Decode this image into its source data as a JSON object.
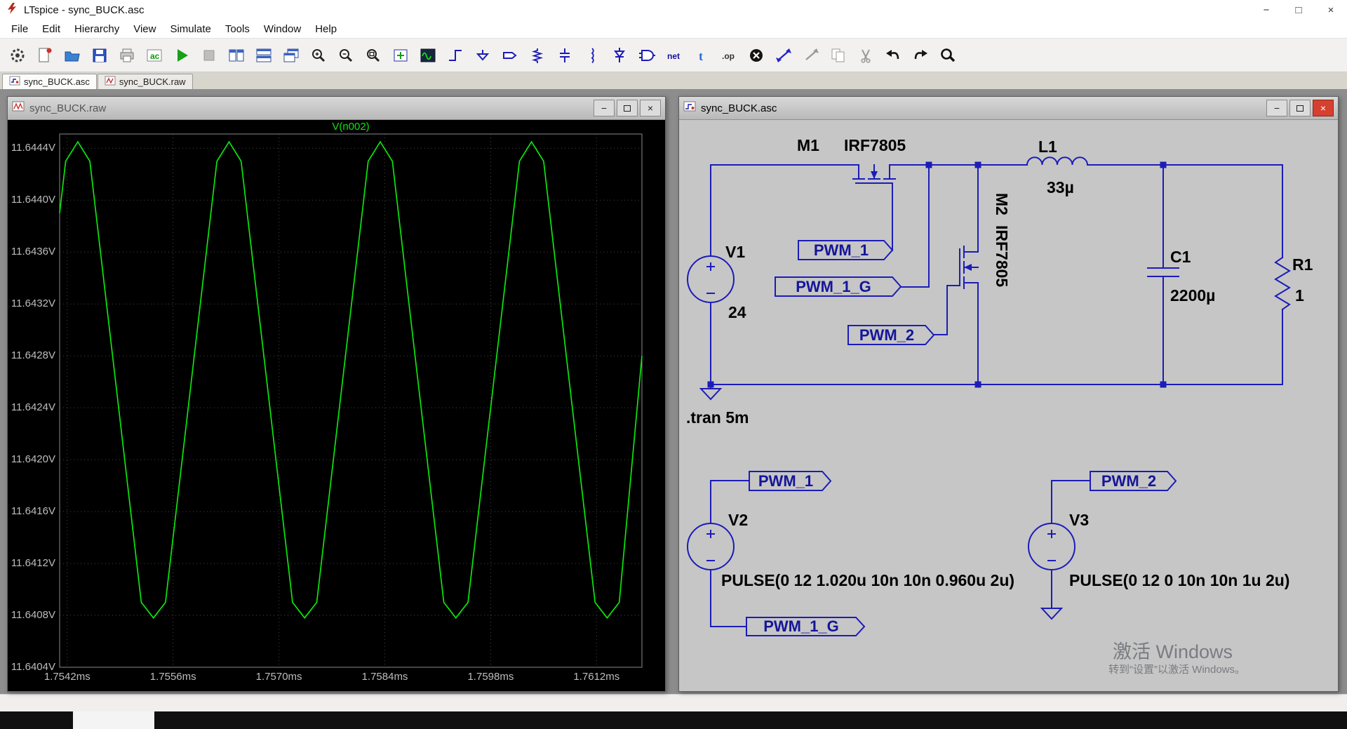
{
  "window": {
    "title": "LTspice - sync_BUCK.asc",
    "controls": {
      "minimize": "−",
      "maximize": "□",
      "close": "×"
    }
  },
  "menu": {
    "items": [
      "File",
      "Edit",
      "Hierarchy",
      "View",
      "Simulate",
      "Tools",
      "Window",
      "Help"
    ]
  },
  "toolbar": {
    "icons": [
      "control-panel",
      "new-schematic",
      "open-file",
      "save",
      "print",
      "ac-analysis",
      "run",
      "halt",
      "tile-vertical",
      "tile-horizontal",
      "cascade-windows",
      "zoom-in",
      "zoom-out",
      "zoom-full-extents",
      "pan-view",
      "plot-settings",
      "draw-wire",
      "place-ground",
      "label-net",
      "place-resistor",
      "place-capacitor",
      "place-inductor",
      "place-diode",
      "place-component",
      "highlight-net",
      "place-text",
      "spice-directive",
      "delete-mode",
      "move-mode",
      "drag-mode",
      "copy-mode",
      "cut-mode",
      "undo",
      "redo",
      "find"
    ]
  },
  "tabs": [
    {
      "label": "sync_BUCK.asc"
    },
    {
      "label": "sync_BUCK.raw"
    }
  ],
  "wave_window": {
    "title": "sync_BUCK.raw"
  },
  "chart_data": {
    "type": "line",
    "title": "V(n002)",
    "trace_color": "#0ce60c",
    "legend_position": "top",
    "grid": true,
    "xlim": [
      1.7541,
      1.7618
    ],
    "ylim": [
      11.6404,
      11.64451
    ],
    "x_unit": "ms",
    "y_unit": "V",
    "x_ticks": [
      1.7542,
      1.7556,
      1.757,
      1.7584,
      1.7598,
      1.7612
    ],
    "x_tick_labels": [
      "1.7542ms",
      "1.7556ms",
      "1.7570ms",
      "1.7584ms",
      "1.7598ms",
      "1.7612ms"
    ],
    "y_ticks": [
      11.6444,
      11.644,
      11.6436,
      11.6432,
      11.6428,
      11.6424,
      11.642,
      11.6416,
      11.6412,
      11.6408,
      11.6404
    ],
    "y_tick_labels": [
      "11.6444V",
      "11.6440V",
      "11.6436V",
      "11.6432V",
      "11.6428V",
      "11.6424V",
      "11.6420V",
      "11.6416V",
      "11.6412V",
      "11.6408V",
      "11.6404V"
    ],
    "series": [
      {
        "name": "V(n002)",
        "points": [
          [
            1.7541,
            11.6439
          ],
          [
            1.75418,
            11.6443
          ],
          [
            1.75434,
            11.64445
          ],
          [
            1.7545,
            11.6443
          ],
          [
            1.75484,
            11.6426
          ],
          [
            1.75518,
            11.6409
          ],
          [
            1.75534,
            11.64078
          ],
          [
            1.7555,
            11.6409
          ],
          [
            1.75584,
            11.6426
          ],
          [
            1.75618,
            11.6443
          ],
          [
            1.75634,
            11.64445
          ],
          [
            1.7565,
            11.6443
          ],
          [
            1.75684,
            11.6426
          ],
          [
            1.75718,
            11.6409
          ],
          [
            1.75734,
            11.64078
          ],
          [
            1.7575,
            11.6409
          ],
          [
            1.75784,
            11.6426
          ],
          [
            1.75818,
            11.6443
          ],
          [
            1.75834,
            11.64445
          ],
          [
            1.7585,
            11.6443
          ],
          [
            1.75884,
            11.6426
          ],
          [
            1.75918,
            11.6409
          ],
          [
            1.75934,
            11.64078
          ],
          [
            1.7595,
            11.6409
          ],
          [
            1.75984,
            11.6426
          ],
          [
            1.76018,
            11.6443
          ],
          [
            1.76034,
            11.64445
          ],
          [
            1.7605,
            11.6443
          ],
          [
            1.76084,
            11.6426
          ],
          [
            1.76118,
            11.6409
          ],
          [
            1.76134,
            11.64078
          ],
          [
            1.7615,
            11.6409
          ],
          [
            1.7618,
            11.6428
          ]
        ]
      }
    ]
  },
  "schematic": {
    "title": "sync_BUCK.asc",
    "directive": ".tran 5m",
    "components": {
      "m1": {
        "name": "M1",
        "value": "IRF7805"
      },
      "m2": {
        "name": "M2",
        "value": "IRF7805"
      },
      "l1": {
        "name": "L1",
        "value": "33µ"
      },
      "c1": {
        "name": "C1",
        "value": "2200µ"
      },
      "r1": {
        "name": "R1",
        "value": "1"
      },
      "v1": {
        "name": "V1",
        "value": "24"
      },
      "v2": {
        "name": "V2",
        "value": "PULSE(0 12 1.020u 10n 10n 0.960u 2u)"
      },
      "v3": {
        "name": "V3",
        "value": "PULSE(0 12 0 10n 10n 1u 2u)"
      }
    },
    "net_labels": {
      "pwm1": "PWM_1",
      "pwm1_g": "PWM_1_G",
      "pwm2": "PWM_2"
    },
    "watermark": {
      "line1": "激活 Windows",
      "line2": "转到“设置”以激活 Windows。"
    }
  }
}
